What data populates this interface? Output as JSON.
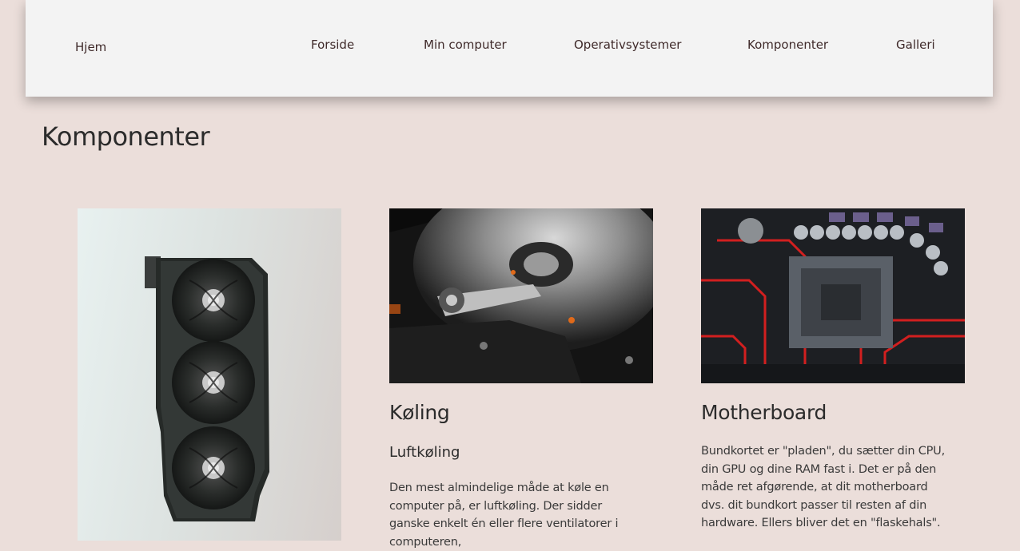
{
  "header": {
    "home_label": "Hjem",
    "nav": [
      "Forside",
      "Min computer",
      "Operativsystemer",
      "Komponenter",
      "Galleri"
    ]
  },
  "page": {
    "title": "Komponenter"
  },
  "cards": {
    "cooling": {
      "title": "Køling",
      "subtitle": "Luftkøling",
      "text": "Den mest almindelige måde at køle en computer på, er luftkøling. Der sidder ganske enkelt én eller flere ventilatorer i computeren,"
    },
    "motherboard": {
      "title": "Motherboard",
      "text": "Bundkortet er \"pladen\", du sætter din CPU, din GPU og dine RAM fast i. Det er på den måde ret afgørende, at dit motherboard dvs. dit bundkort passer til resten af din hardware. Ellers bliver det en \"flaskehals\"."
    }
  },
  "images": [
    "graphics-card-photo",
    "hard-drive-photo",
    "motherboard-photo"
  ],
  "colors": {
    "background": "#ebdeda",
    "header": "#f3f3f3",
    "nav_text": "#3f2a2a",
    "heading": "#2b2b2b",
    "accent_red": "#d21f1f"
  }
}
